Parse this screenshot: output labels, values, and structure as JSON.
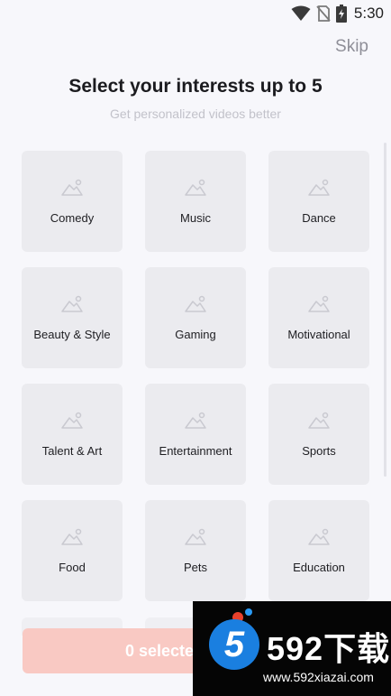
{
  "status_bar": {
    "time": "5:30",
    "icons": [
      "wifi-icon",
      "no-sim-icon",
      "battery-charging-icon"
    ]
  },
  "header": {
    "skip_label": "Skip",
    "title": "Select your interests up to 5",
    "subtitle": "Get personalized videos better"
  },
  "interests": [
    {
      "label": "Comedy"
    },
    {
      "label": "Music"
    },
    {
      "label": "Dance"
    },
    {
      "label": "Beauty & Style"
    },
    {
      "label": "Gaming"
    },
    {
      "label": "Motivational"
    },
    {
      "label": "Talent & Art"
    },
    {
      "label": "Entertainment"
    },
    {
      "label": "Sports"
    },
    {
      "label": "Food"
    },
    {
      "label": "Pets"
    },
    {
      "label": "Education"
    }
  ],
  "footer": {
    "select_label": "0 selected"
  },
  "watermark": {
    "brand": "592下载",
    "url": "www.592xiazai.com"
  },
  "colors": {
    "background": "#f7f7fb",
    "card": "#ebebef",
    "button": "#f9c9c3",
    "title": "#1b1b1f",
    "subtitle": "#c2c2ca"
  }
}
